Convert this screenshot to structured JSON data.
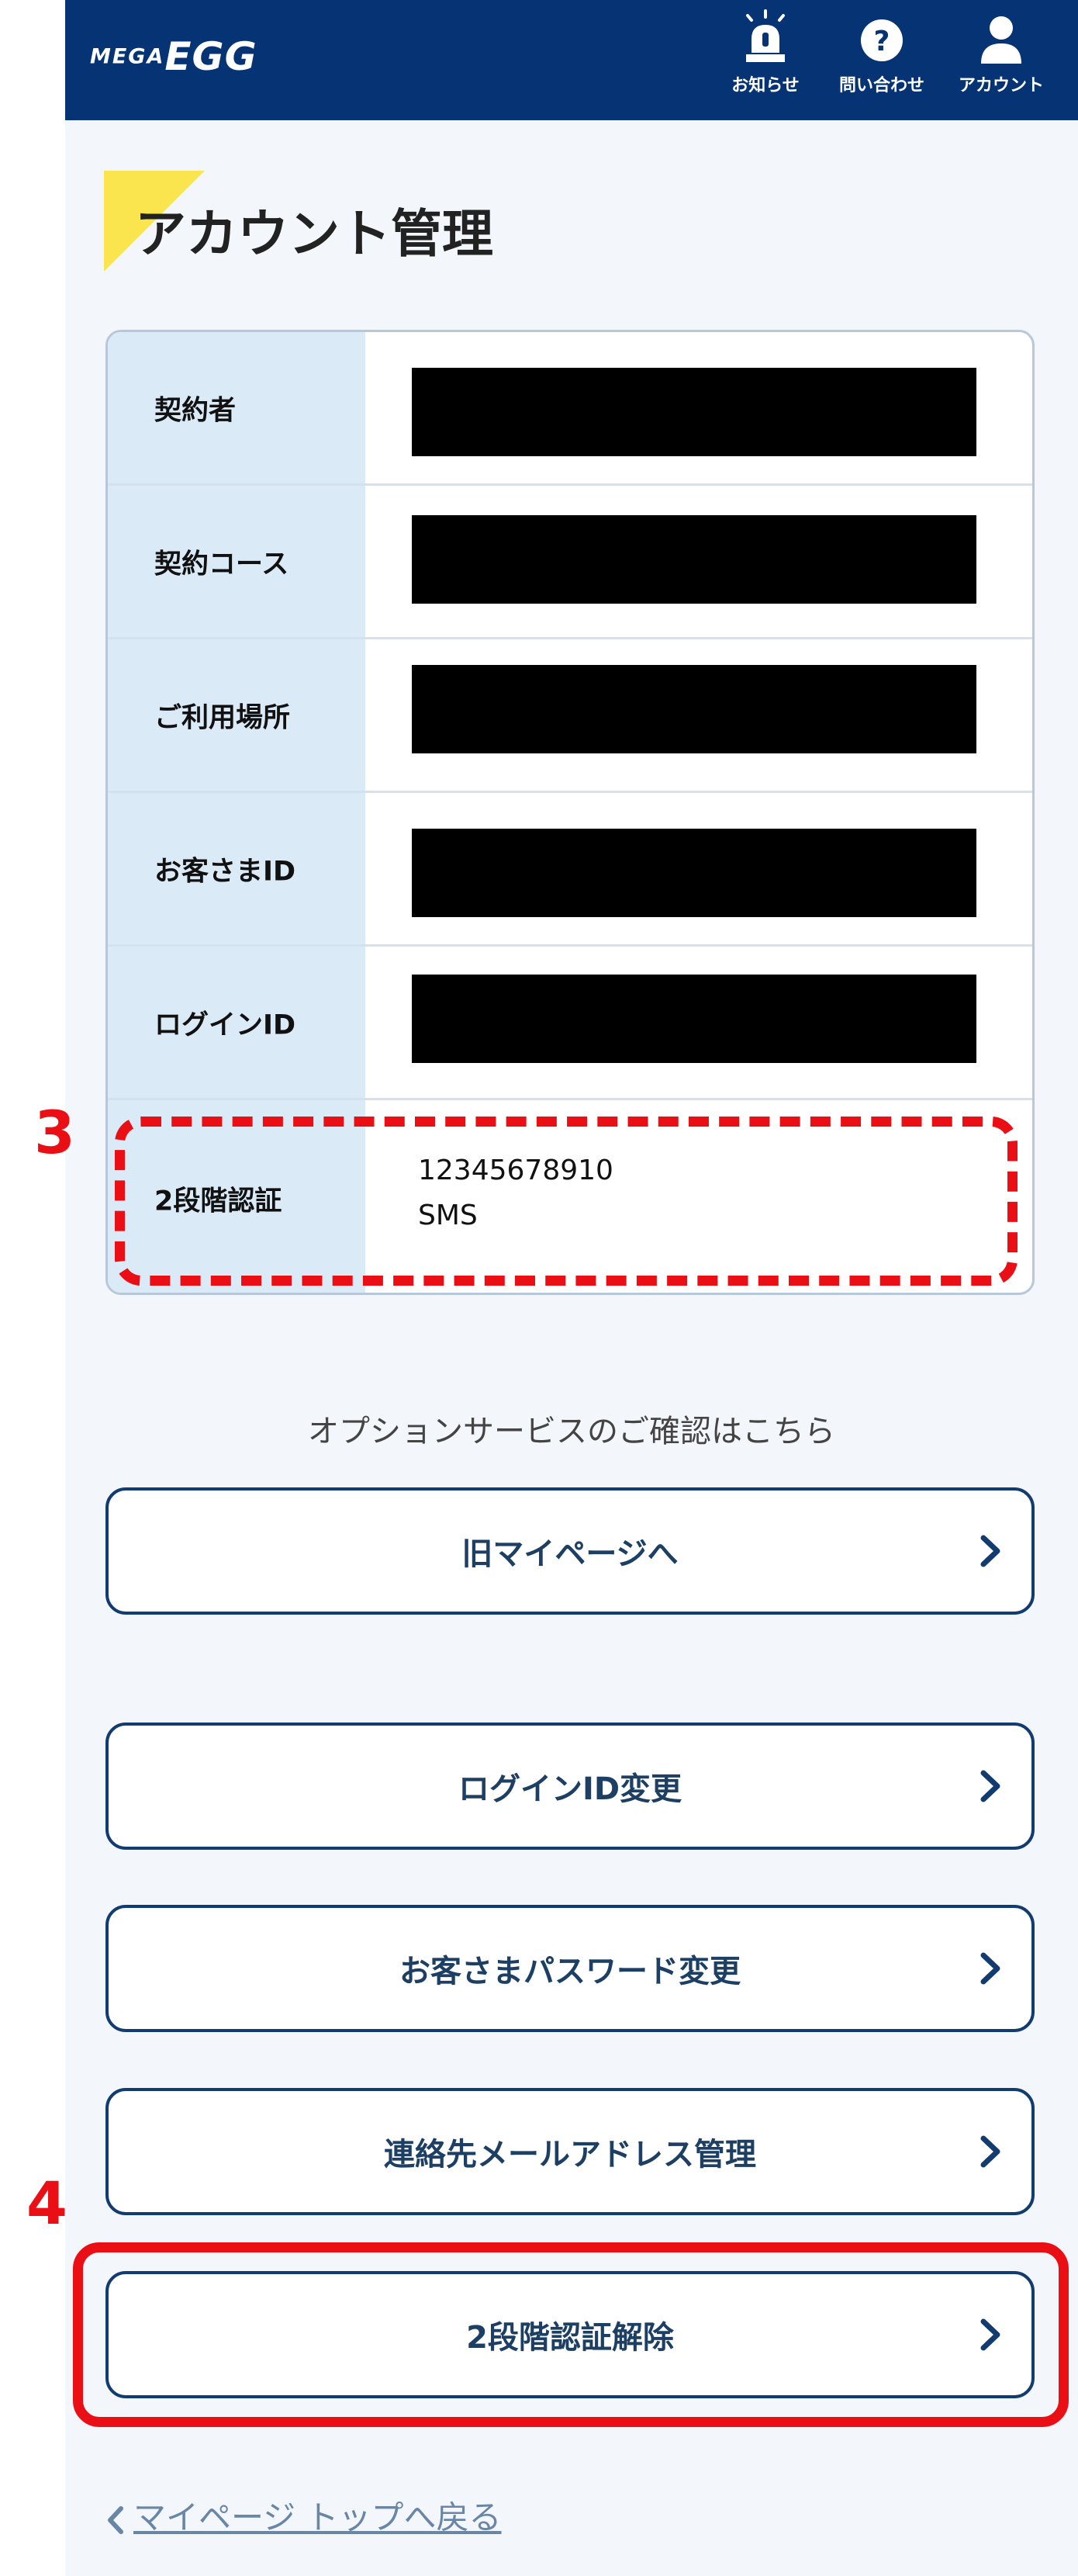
{
  "header": {
    "logo_prefix": "MEGA",
    "logo_main": "EGG",
    "notices_label": "お知らせ",
    "contact_label": "問い合わせ",
    "account_label": "アカウント",
    "colors": {
      "bar": "#053373",
      "icon": "#ffffff"
    }
  },
  "page": {
    "title": "アカウント管理"
  },
  "info_table": {
    "rows": [
      {
        "label": "契約者"
      },
      {
        "label": "契約コース"
      },
      {
        "label": "ご利用場所"
      },
      {
        "label": "お客さまID"
      },
      {
        "label": "ログインID"
      },
      {
        "label": "2段階認証",
        "value_line1": "12345678910",
        "value_line2": "SMS"
      }
    ]
  },
  "annotations": {
    "marker_3": "3",
    "marker_4": "4",
    "color": "#ea0f15"
  },
  "options_caption": "オプションサービスのご確認はこちら",
  "buttons": {
    "old_mypage": "旧マイページへ",
    "login_id_change": "ログインID変更",
    "password_change": "お客さまパスワード変更",
    "email_manage": "連絡先メールアドレス管理",
    "tfa_release": "2段階認証解除"
  },
  "back_link": "マイページ トップへ戻る",
  "icons": [
    "alarm-light-icon",
    "question-icon",
    "person-icon",
    "chevron-right-icon",
    "chevron-left-icon"
  ]
}
